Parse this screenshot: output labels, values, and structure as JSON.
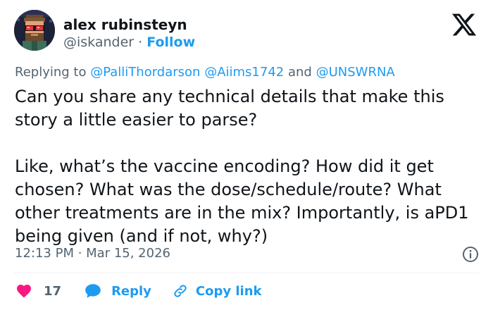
{
  "author": {
    "display_name": "alex rubinsteyn",
    "handle": "@iskander",
    "separator": "·",
    "follow_label": "Follow",
    "avatar_icon": "pixel-art-avatar-icon"
  },
  "brand": {
    "logo_icon": "x-logo-icon"
  },
  "reply_context": {
    "prefix": "Replying to",
    "mentions": [
      "@PalliThordarson",
      "@Aiims1742",
      "@UNSWRNA"
    ],
    "conjunction": "and"
  },
  "tweet": {
    "paragraphs": [
      "Can you share any technical details that make this story a little easier to parse?",
      "Like, what’s the vaccine encoding? How did it get chosen? What was the dose/schedule/route? What other treatments are in the mix? Importantly, is aPD1 being given (and if not, why?)"
    ],
    "timestamp": "12:13 PM · Mar 15, 2026"
  },
  "actions": {
    "like_count": "17",
    "reply_label": "Reply",
    "copy_link_label": "Copy link",
    "like_icon": "heart-icon",
    "reply_icon": "speech-bubble-icon",
    "copy_icon": "link-icon",
    "info_icon": "info-icon"
  },
  "colors": {
    "text": "#0f1419",
    "secondary": "#536471",
    "accent": "#1d9bf0",
    "like": "#f91880"
  }
}
